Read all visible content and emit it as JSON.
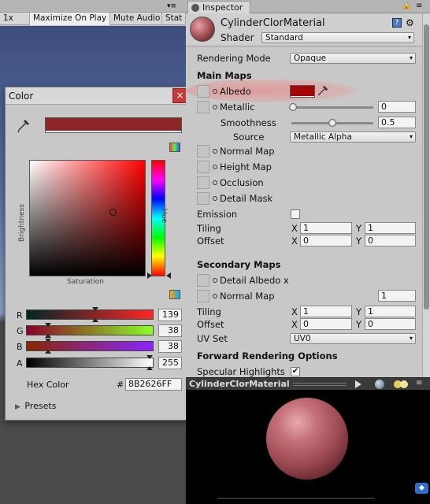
{
  "game_toolbar": {
    "scale": "1x",
    "maximize": "Maximize On Play",
    "mute": "Mute Audio",
    "stats": "Stat"
  },
  "color_picker": {
    "title": "Color",
    "close": "×",
    "brightness_label": "Brightness",
    "hue_label": "Hue",
    "saturation_label": "Saturation",
    "color_hex": "#8b2626",
    "channels": [
      {
        "label": "R",
        "value": "139",
        "frac": 0.545
      },
      {
        "label": "G",
        "value": "38",
        "frac": 0.149
      },
      {
        "label": "B",
        "value": "38",
        "frac": 0.149
      },
      {
        "label": "A",
        "value": "255",
        "frac": 1.0
      }
    ],
    "hex_label": "Hex Color",
    "hex_hash": "#",
    "hex_value": "8B2626FF",
    "presets": "Presets"
  },
  "inspector": {
    "tab": "Inspector",
    "material_name": "CylinderClorMaterial",
    "shader_label": "Shader",
    "shader_value": "Standard",
    "rendering_mode_label": "Rendering Mode",
    "rendering_mode_value": "Opaque",
    "main_maps": "Main Maps",
    "albedo": "Albedo",
    "metallic": "Metallic",
    "metallic_value": "0",
    "smoothness": "Smoothness",
    "smoothness_value": "0.5",
    "smoothness_frac": 0.5,
    "source": "Source",
    "source_value": "Metallic Alpha",
    "normal_map": "Normal Map",
    "height_map": "Height Map",
    "occlusion": "Occlusion",
    "detail_mask": "Detail Mask",
    "emission": "Emission",
    "tiling": "Tiling",
    "offset": "Offset",
    "x": "X",
    "y": "Y",
    "tiling_x": "1",
    "tiling_y": "1",
    "offset_x": "0",
    "offset_y": "0",
    "secondary_maps": "Secondary Maps",
    "detail_albedo": "Detail Albedo x",
    "normal_map2": "Normal Map",
    "normal_map2_value": "1",
    "tiling2_x": "1",
    "tiling2_y": "1",
    "offset2_x": "0",
    "offset2_y": "0",
    "uv_set": "UV Set",
    "uv_set_value": "UV0",
    "forward_options": "Forward Rendering Options",
    "specular_highlights": "Specular Highlights",
    "specular_checked": "✔",
    "albedo_color": "#a50505"
  },
  "preview": {
    "title": "CylinderClorMaterial"
  },
  "icons": [
    "eyedropper-icon",
    "help-icon",
    "gear-icon",
    "play-icon",
    "sphere-icon",
    "light-icon",
    "tag-icon"
  ]
}
